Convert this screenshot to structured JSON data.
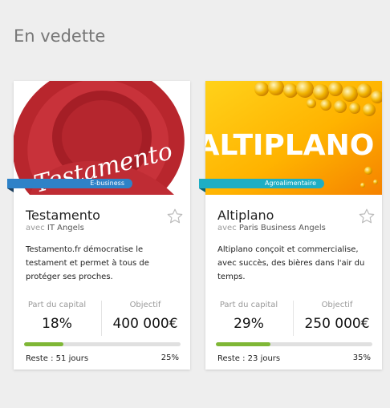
{
  "section": {
    "title": "En vedette"
  },
  "cards": [
    {
      "name": "Testamento",
      "with_prefix": "avec",
      "partner": "IT Angels",
      "category": "E-business",
      "hero_text": "Testamento",
      "description": "Testamento.fr démocratise le testament et permet à tous de protéger ses proches.",
      "stat_labels": [
        "Part du capital",
        "Objectif"
      ],
      "stat_values": [
        "18%",
        "400 000€"
      ],
      "progress": 0.25,
      "remaining": "Reste : 51 jours",
      "percent": "25%",
      "icons": {
        "favorite": "star-outline-icon"
      }
    },
    {
      "name": "Altiplano",
      "with_prefix": "avec",
      "partner": "Paris Business Angels",
      "category": "Agroalimentaire",
      "hero_text": "ALTIPLANO",
      "description": "Altiplano conçoit et commercialise, avec succès, des bières dans l'air du temps.",
      "stat_labels": [
        "Part du capital",
        "Objectif"
      ],
      "stat_values": [
        "29%",
        "250 000€"
      ],
      "progress": 0.35,
      "remaining": "Reste : 23 jours",
      "percent": "35%",
      "icons": {
        "favorite": "star-outline-icon"
      }
    }
  ],
  "colors": {
    "progress_fill": "#7fb736",
    "ebusiness": "#2e82c8",
    "agro": "#1eaec4"
  }
}
